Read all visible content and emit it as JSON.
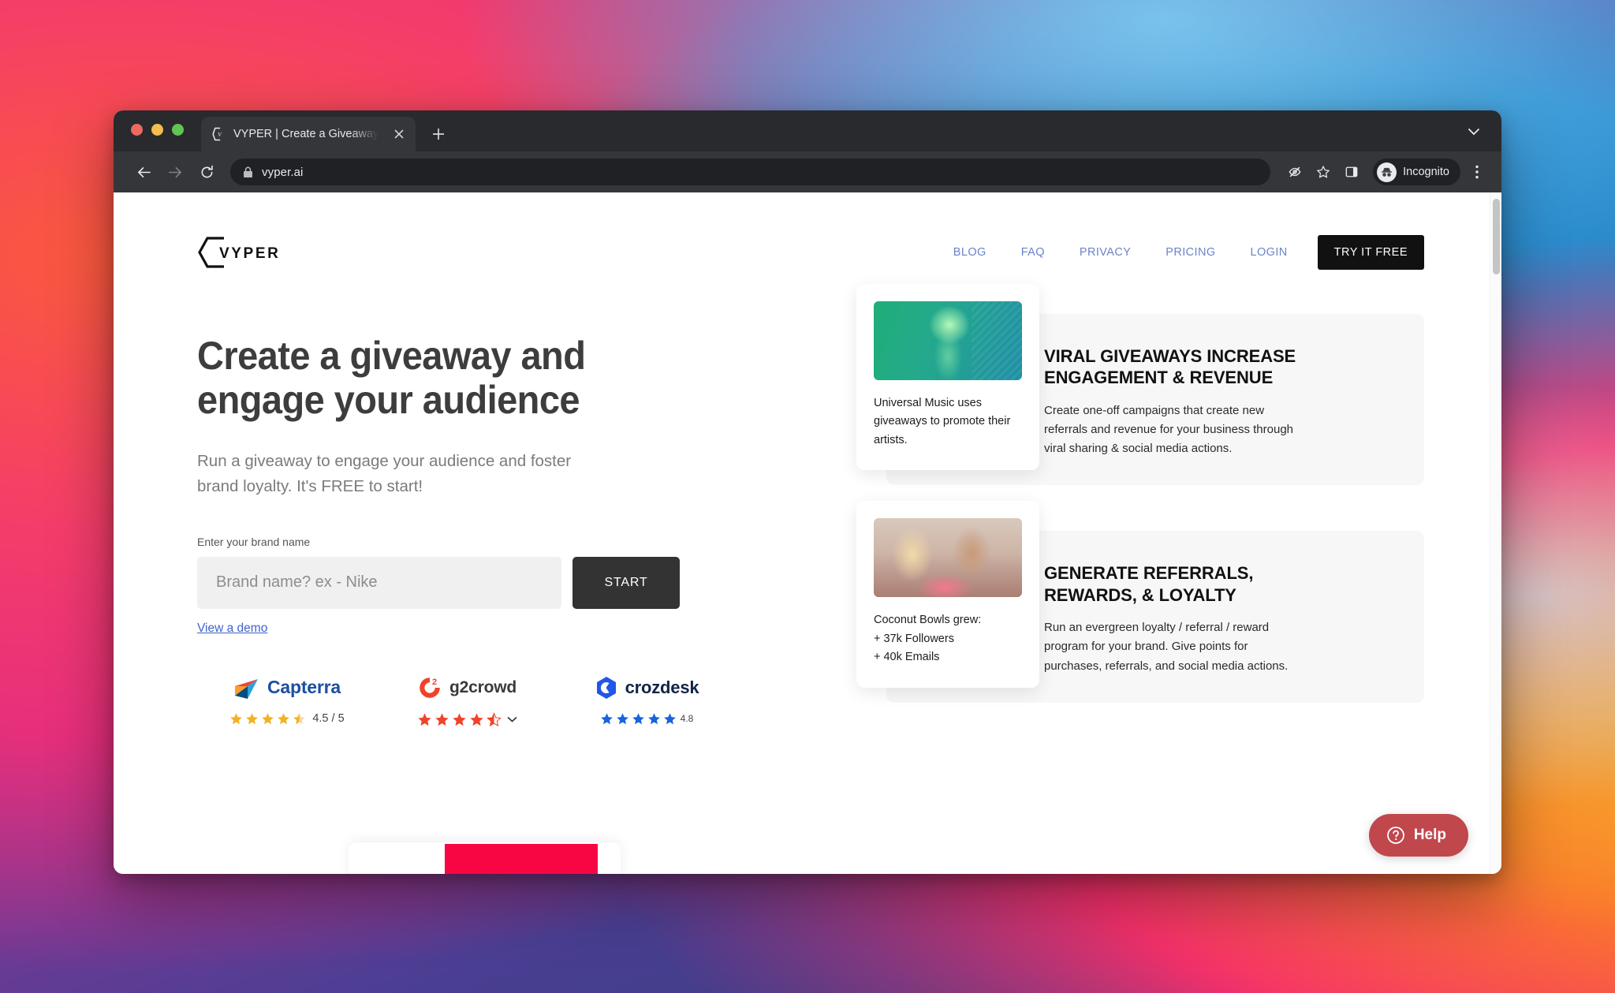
{
  "browser": {
    "tab": {
      "title": "VYPER | Create a Giveaway or V",
      "favicon_icon": "vyper-logo-icon",
      "close_icon": "close-icon"
    },
    "newtab_icon": "plus-icon",
    "tabstrip_chevron_icon": "chevron-down-icon",
    "nav": {
      "back_icon": "arrow-left-icon",
      "forward_icon": "arrow-right-icon",
      "reload_icon": "reload-icon"
    },
    "omnibox": {
      "lock_icon": "lock-icon",
      "url": "vyper.ai"
    },
    "actions": {
      "tracking_protection_icon": "eye-off-icon",
      "bookmark_icon": "star-icon",
      "side_panel_icon": "side-panel-icon",
      "profile_icon": "incognito-icon",
      "profile_label": "Incognito",
      "menu_icon": "kebab-menu-icon"
    }
  },
  "site": {
    "logo_text": "VYPER",
    "nav_links": [
      {
        "label": "BLOG"
      },
      {
        "label": "FAQ"
      },
      {
        "label": "PRIVACY"
      },
      {
        "label": "PRICING"
      },
      {
        "label": "LOGIN"
      }
    ],
    "cta_label": "TRY IT FREE",
    "hero": {
      "headline_line1": "Create a giveaway and",
      "headline_line2": "engage your audience",
      "subhead": "Run a giveaway to engage your audience and foster brand loyalty. It's FREE to start!",
      "form_label": "Enter your brand name",
      "input_placeholder": "Brand name? ex - Nike",
      "input_value": "",
      "start_label": "START",
      "demo_link": "View a demo"
    },
    "badges": [
      {
        "name": "Capterra",
        "score": "4.5 / 5",
        "stars": 4.5,
        "color": "#1d4ea0",
        "star_color": "#f5b120",
        "icon": "capterra-logo-icon",
        "has_chevron": false
      },
      {
        "name": "g2crowd",
        "score": "",
        "stars": 4.5,
        "color": "#3a3a3a",
        "star_color": "#f04b28",
        "icon": "g2crowd-logo-icon",
        "has_chevron": true
      },
      {
        "name": "crozdesk",
        "score": "4.8",
        "stars": 5,
        "color": "#122446",
        "star_color": "#1a63d8",
        "icon": "crozdesk-logo-icon",
        "has_chevron": false
      }
    ],
    "features": [
      {
        "card_caption": "Universal Music uses giveaways to promote their artists.",
        "title": "VIRAL GIVEAWAYS INCREASE ENGAGEMENT & REVENUE",
        "body": "Create one-off campaigns that create new referrals and revenue for your business through viral sharing & social media actions.",
        "thumb": "universal-music-thumbnail"
      },
      {
        "card_caption": "Coconut Bowls grew:\n+ 37k Followers\n+ 40k Emails",
        "title": "GENERATE REFERRALS, REWARDS, & LOYALTY",
        "body": "Run an evergreen loyalty / referral / reward program for your brand. Give points for purchases, referrals, and social media actions.",
        "thumb": "coconut-bowls-thumbnail"
      }
    ],
    "help_widget": {
      "label": "Help",
      "icon": "question-circle-icon",
      "color": "#c0474c"
    }
  }
}
